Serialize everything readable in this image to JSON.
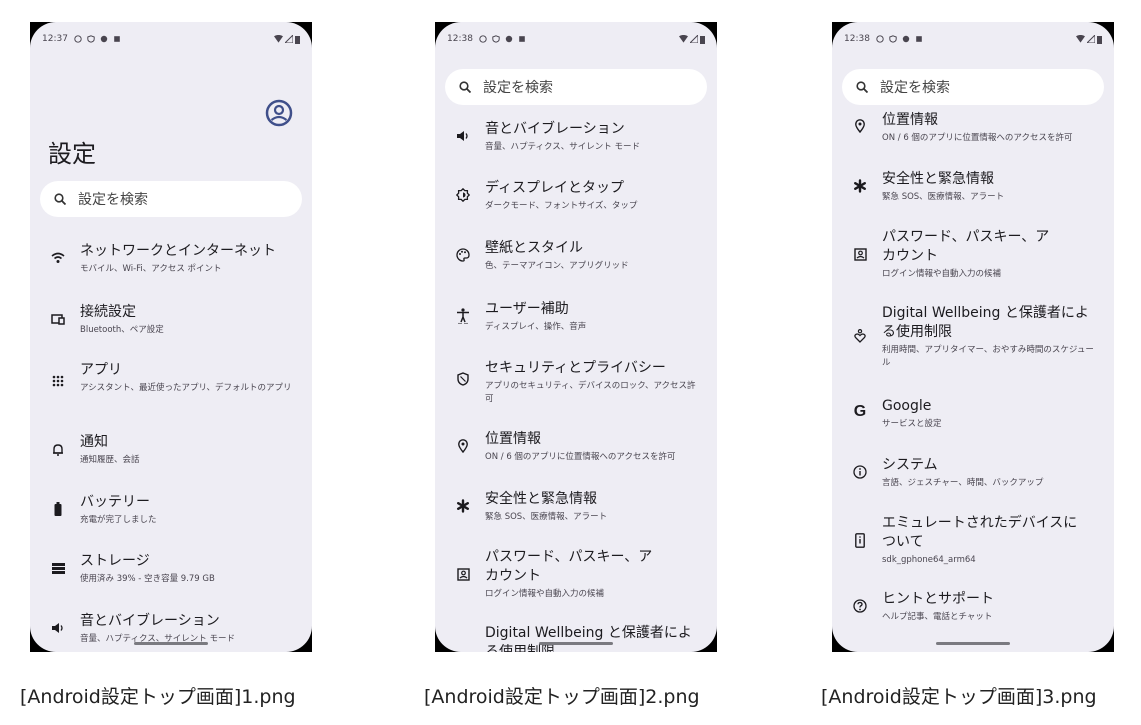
{
  "search_placeholder": "設定を検索",
  "screens": [
    {
      "time": "12:37",
      "title": "設定",
      "items": [
        {
          "t": "ネットワークとインターネット",
          "s": "モバイル、Wi-Fi、アクセス ポイント"
        },
        {
          "t": "接続設定",
          "s": "Bluetooth、ペア設定"
        },
        {
          "t": "アプリ",
          "s": "アシスタント、最近使ったアプリ、デフォルトのアプリ"
        },
        {
          "t": "通知",
          "s": "通知履歴、会話"
        },
        {
          "t": "バッテリー",
          "s": "充電が完了しました"
        },
        {
          "t": "ストレージ",
          "s": "使用済み 39% - 空き容量 9.79 GB"
        },
        {
          "t": "音とバイブレーション",
          "s": "音量、ハプティクス、サイレント モード"
        }
      ],
      "caption": "[Android設定トップ画面]1.png"
    },
    {
      "time": "12:38",
      "items": [
        {
          "t": "音とバイブレーション",
          "s": "音量、ハプティクス、サイレント モード"
        },
        {
          "t": "ディスプレイとタップ",
          "s": "ダークモード、フォントサイズ、タップ"
        },
        {
          "t": "壁紙とスタイル",
          "s": "色、テーマアイコン、アプリグリッド"
        },
        {
          "t": "ユーザー補助",
          "s": "ディスプレイ、操作、音声"
        },
        {
          "t": "セキュリティとプライバシー",
          "s": "アプリのセキュリティ、デバイスのロック、アクセス許可"
        },
        {
          "t": "位置情報",
          "s": "ON / 6 個のアプリに位置情報へのアクセスを許可"
        },
        {
          "t": "安全性と緊急情報",
          "s": "緊急 SOS、医療情報、アラート"
        },
        {
          "t": "パスワード、パスキー、アカウント",
          "s": "ログイン情報や自動入力の候補"
        },
        {
          "t": "Digital Wellbeing と保護者による使用制限",
          "s": ""
        }
      ],
      "caption": "[Android設定トップ画面]2.png"
    },
    {
      "time": "12:38",
      "items": [
        {
          "t": "位置情報",
          "s": "ON / 6 個のアプリに位置情報へのアクセスを許可"
        },
        {
          "t": "安全性と緊急情報",
          "s": "緊急 SOS、医療情報、アラート"
        },
        {
          "t": "パスワード、パスキー、アカウント",
          "s": "ログイン情報や自動入力の候補"
        },
        {
          "t": "Digital Wellbeing と保護者による使用制限",
          "s": "利用時間、アプリタイマー、おやすみ時間のスケジュール"
        },
        {
          "t": "Google",
          "s": "サービスと設定"
        },
        {
          "t": "システム",
          "s": "言語、ジェスチャー、時間、バックアップ"
        },
        {
          "t": "エミュレートされたデバイスについて",
          "s": "sdk_gphone64_arm64"
        },
        {
          "t": "ヒントとサポート",
          "s": "ヘルプ記事、電話とチャット"
        }
      ],
      "caption": "[Android設定トップ画面]3.png"
    }
  ]
}
